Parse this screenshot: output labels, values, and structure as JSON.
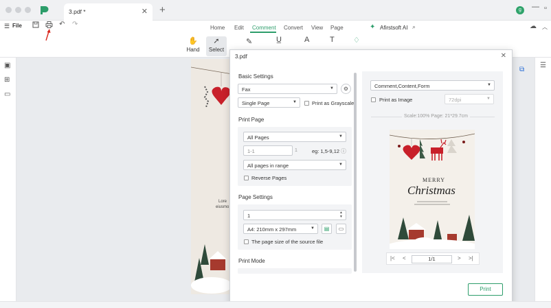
{
  "tab": {
    "title": "3.pdf *"
  },
  "account": {
    "avatar_letter": "g"
  },
  "menu": {
    "file": "File"
  },
  "nav_tabs": [
    "Home",
    "Edit",
    "Comment",
    "Convert",
    "View",
    "Page"
  ],
  "ai": {
    "label": "Afirstsoft AI"
  },
  "tools": {
    "hand": "Hand",
    "select": "Select"
  },
  "background_doc": {
    "text_line1": "Lore",
    "text_line2": "eiusmo"
  },
  "dialog": {
    "title": "3.pdf",
    "basic_settings": {
      "heading": "Basic Settings",
      "printer": "Fax",
      "page_mode": "Single Page",
      "grayscale_label": "Print as Grayscale"
    },
    "print_page": {
      "heading": "Print Page",
      "range": "All Pages",
      "custom_range": "1-1",
      "custom_range_suffix": "1",
      "example": "eg: 1,5-9,12",
      "subset": "All pages in range",
      "reverse_label": "Reverse Pages"
    },
    "page_settings": {
      "heading": "Page Settings",
      "copies": "1",
      "paper_size": "A4: 210mm x 297mm",
      "source_size_label": "The page size of the source file"
    },
    "print_mode": {
      "heading": "Print Mode"
    },
    "preview": {
      "content": "Comment,Content,Form",
      "print_as_image_label": "Print as Image",
      "dpi": "72dpi",
      "scale_info": "Scale:100%   Page: 21*29.7cm",
      "card_line1": "MERRY",
      "card_line2": "Christmas",
      "page_indicator": "1/1"
    },
    "print_button": "Print"
  },
  "colors": {
    "accent": "#2c9d6a",
    "heart": "#c8202a",
    "tree": "#2f4a3a"
  }
}
